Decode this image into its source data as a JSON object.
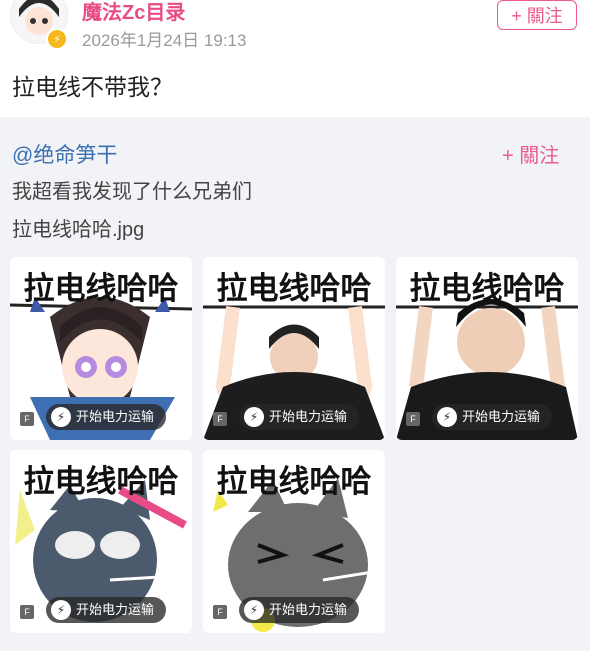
{
  "header": {
    "author": "魔法Zc目录",
    "time": "2026年1月24日 19:13",
    "follow_label": "+ 關注"
  },
  "post": {
    "text": "拉电线不带我？"
  },
  "repost": {
    "user": "@绝命笋干",
    "follow_label": "+ 關注",
    "line1": "我超看我发现了什么兄弟们",
    "line2": "拉电线哈哈.jpg",
    "images": [
      {
        "title": "拉电线哈哈",
        "pill": "开始电力运输",
        "badge": "F",
        "kind": "anime"
      },
      {
        "title": "拉电线哈哈",
        "pill": "开始电力运输",
        "badge": "F",
        "kind": "man1"
      },
      {
        "title": "拉电线哈哈",
        "pill": "开始电力运输",
        "badge": "F",
        "kind": "man2"
      },
      {
        "title": "拉电线哈哈",
        "pill": "开始电力运输",
        "badge": "F",
        "kind": "cat1"
      },
      {
        "title": "拉电线哈哈",
        "pill": "开始电力运输",
        "badge": "F",
        "kind": "cat2"
      }
    ]
  },
  "colors": {
    "accent": "#e95b8c",
    "link": "#3b6fb0"
  }
}
